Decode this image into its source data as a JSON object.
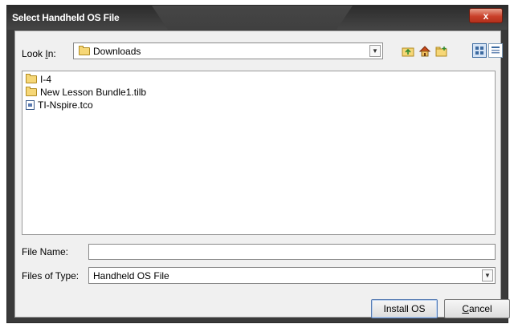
{
  "window": {
    "title": "Select Handheld OS File",
    "close_glyph": "x"
  },
  "look_in": {
    "label_prefix": "Look ",
    "label_mnemonic": "I",
    "label_suffix": "n:",
    "value": "Downloads",
    "dropdown_glyph": "▼"
  },
  "toolbar": {
    "icons": [
      "up-one-level-icon",
      "home-icon",
      "new-folder-icon",
      "list-view-icon",
      "details-view-icon"
    ]
  },
  "files": [
    {
      "name": "I-4",
      "icon": "folder-icon"
    },
    {
      "name": "New Lesson Bundle1.tilb",
      "icon": "folder-icon"
    },
    {
      "name": "TI-Nspire.tco",
      "icon": "file-icon"
    }
  ],
  "file_name": {
    "label": "File Name:",
    "value": ""
  },
  "files_of_type": {
    "label": "Files of Type:",
    "value": "Handheld OS File",
    "dropdown_glyph": "▼"
  },
  "buttons": {
    "install_label": "Install OS",
    "cancel_mnemonic": "C",
    "cancel_rest": "ancel"
  },
  "colors": {
    "titlebar": "#3a3a3a",
    "close_button": "#c9402a",
    "client_background": "#f0f0f0",
    "folder_yellow": "#f6d777"
  }
}
